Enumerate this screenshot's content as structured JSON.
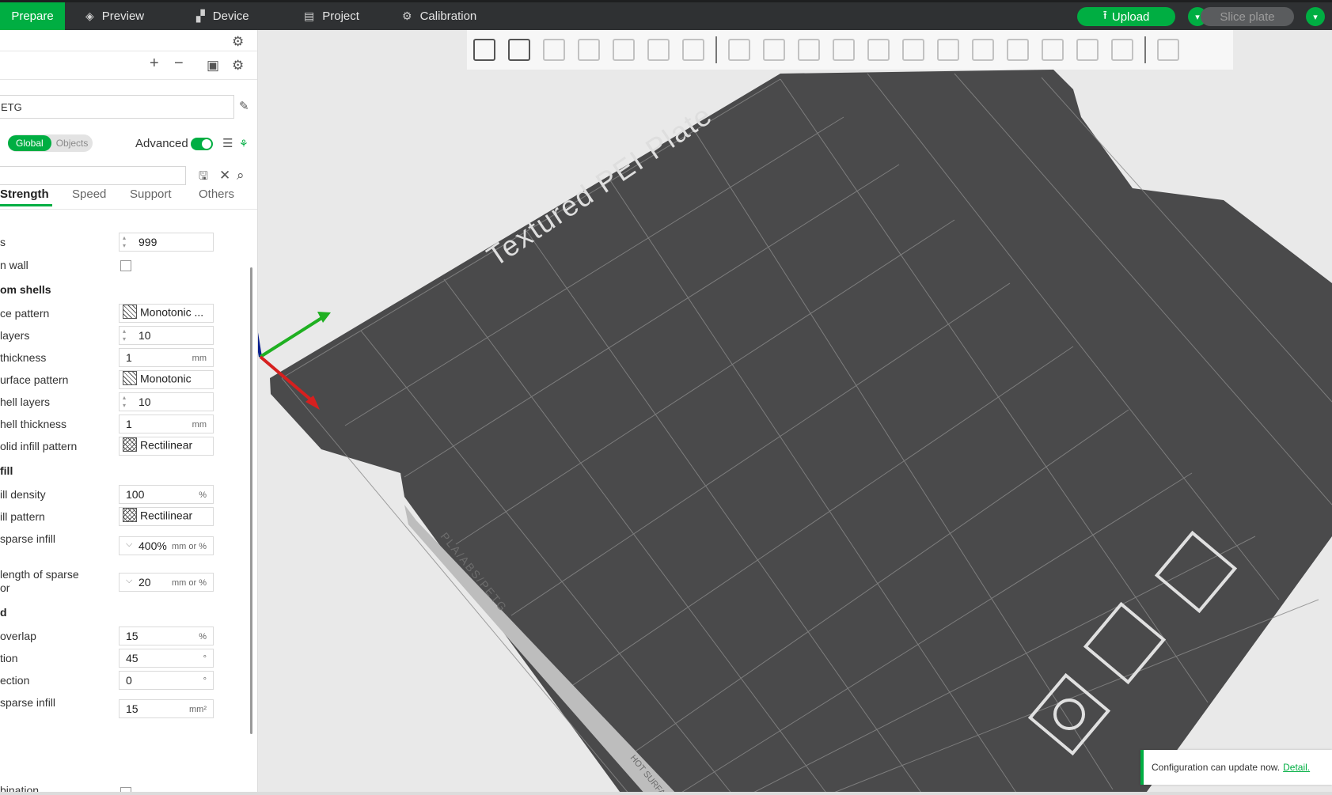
{
  "topbar": {
    "tabs": [
      {
        "label": "Prepare",
        "icon": "prepare-icon"
      },
      {
        "label": "Preview",
        "icon": "layers-icon"
      },
      {
        "label": "Device",
        "icon": "device-icon"
      },
      {
        "label": "Project",
        "icon": "project-icon"
      },
      {
        "label": "Calibration",
        "icon": "calibration-icon"
      }
    ],
    "upload_label": "Upload",
    "slice_label": "Slice plate"
  },
  "sidebar": {
    "filament_value": "ETG",
    "scope_global": "Global",
    "scope_objects": "Objects",
    "advanced_label": "Advanced",
    "tabs": [
      "Strength",
      "Speed",
      "Support",
      "Others"
    ],
    "rows": {
      "walls_label": "s",
      "walls_value": "999",
      "embed_wall_label": "n wall",
      "shells_header": "om shells",
      "top_pattern_label": "ce pattern",
      "top_pattern_value": "Monotonic ...",
      "top_layers_label": "layers",
      "top_layers_value": "10",
      "top_thickness_label": "thickness",
      "top_thickness_value": "1",
      "bottom_pattern_label": "urface pattern",
      "bottom_pattern_value": "Monotonic",
      "bottom_layers_label": "hell layers",
      "bottom_layers_value": "10",
      "bottom_thickness_label": "hell thickness",
      "bottom_thickness_value": "1",
      "solid_pattern_label": "olid infill pattern",
      "solid_pattern_value": "Rectilinear",
      "infill_header": "fill",
      "density_label": "ill density",
      "density_value": "100",
      "infill_pattern_label": "ill pattern",
      "infill_pattern_value": "Rectilinear",
      "sparse_anchor_label": " sparse infill",
      "sparse_anchor_value": "400%",
      "anchor_max_label_1": "length of sparse",
      "anchor_max_label_2": "or",
      "anchor_max_value": "20",
      "adv_header": "d",
      "overlap_label": "overlap",
      "overlap_value": "15",
      "direction_label": "tion",
      "direction_value": "45",
      "solid_dir_label": "ection",
      "solid_dir_value": "0",
      "sparse_area_label": "sparse infill",
      "sparse_area_value": "15",
      "combination_label": "bination"
    },
    "units": {
      "mm": "mm",
      "percent": "%",
      "mm_or_pct": "mm or %",
      "deg": "°",
      "mm2": "mm²"
    }
  },
  "plate": {
    "title": "Textured PEI Plate",
    "material_label": "PLA/ABS/PETG",
    "hot_surface": "HOT SURFACE"
  },
  "notice": {
    "text": "Configuration can update now.",
    "link": "Detail."
  },
  "colors": {
    "accent": "#00ae42",
    "topbar": "#2f3133",
    "plate": "#4a4a4b"
  }
}
